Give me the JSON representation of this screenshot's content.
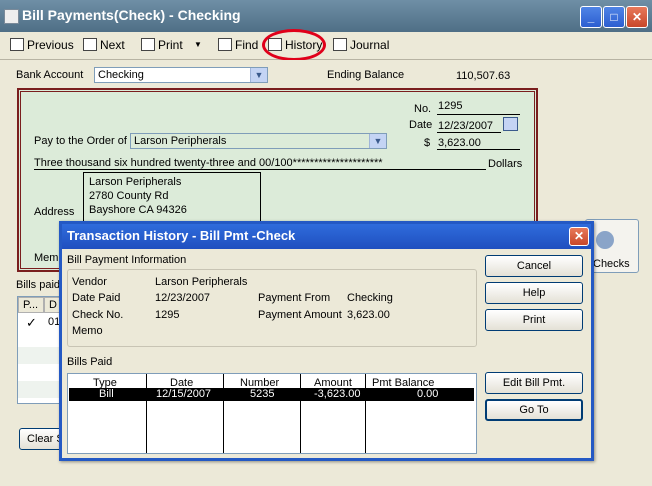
{
  "window": {
    "title": "Bill Payments(Check) - Checking"
  },
  "toolbar": {
    "previous": "Previous",
    "next": "Next",
    "print": "Print",
    "find": "Find",
    "history": "History",
    "journal": "Journal"
  },
  "form": {
    "bank_account_label": "Bank Account",
    "bank_account_value": "Checking",
    "ending_balance_label": "Ending Balance",
    "ending_balance_value": "110,507.63",
    "check": {
      "no_label": "No.",
      "no_value": "1295",
      "date_label": "Date",
      "date_value": "12/23/2007",
      "pay_to_label": "Pay to the Order of",
      "pay_to_value": "Larson Peripherals",
      "dollar_sign": "$",
      "amount_value": "3,623.00",
      "amount_words": "Three thousand six hundred twenty-three and 00/100*********************",
      "dollars_label": "Dollars",
      "address_label": "Address",
      "address_lines": [
        "Larson Peripherals",
        "2780 County Rd",
        "Bayshore CA 94326"
      ],
      "memo_label": "Memo"
    },
    "bills_paid_label": "Bills paid",
    "bills_grid_header_p": "P...",
    "bills_grid_header_d": "D",
    "bills_grid_row_check": "✓",
    "bills_grid_row_date": "01",
    "clear_button": "Clear S",
    "checks_label": "Checks"
  },
  "dialog": {
    "title": "Transaction History - Bill Pmt -Check",
    "info_section_label": "Bill Payment Information",
    "vendor_label": "Vendor",
    "vendor_value": "Larson Peripherals",
    "date_paid_label": "Date Paid",
    "date_paid_value": "12/23/2007",
    "check_no_label": "Check No.",
    "check_no_value": "1295",
    "memo_label": "Memo",
    "payment_from_label": "Payment From",
    "payment_from_value": "Checking",
    "payment_amount_label": "Payment Amount",
    "payment_amount_value": "3,623.00",
    "bills_paid_label": "Bills Paid",
    "table": {
      "headers": [
        "Type",
        "Date",
        "Number",
        "Amount",
        "Pmt Balance"
      ],
      "rows": [
        [
          "Bill",
          "12/15/2007",
          "5235",
          "-3,623.00",
          "0.00"
        ]
      ]
    },
    "buttons": {
      "cancel": "Cancel",
      "help": "Help",
      "print": "Print",
      "edit_bill_pmt": "Edit Bill Pmt.",
      "go_to": "Go To"
    },
    "close_glyph": "✕"
  },
  "colors": {
    "dialog_title_bg": "#2f6cdc",
    "check_bg": "#dcebd9",
    "check_border": "#7a1e1e",
    "highlight_circle": "#e0001a"
  }
}
